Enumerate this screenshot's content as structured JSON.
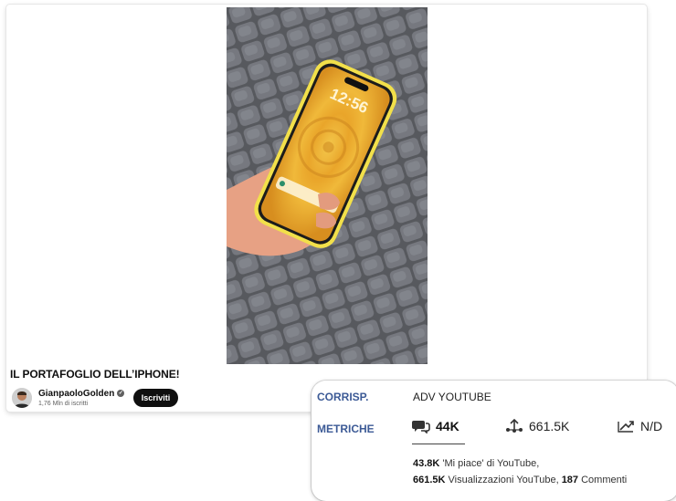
{
  "video": {
    "title": "IL PORTAFOGLIO DELL’IPHONE!",
    "channel_name": "GianpaoloGolden",
    "subscribers": "1,76 Mln di iscritti",
    "subscribe_label": "Iscriviti",
    "phone_time": "12:56"
  },
  "info_panel": {
    "corrisp_label": "CORRISP.",
    "corrisp_value": "ADV YOUTUBE",
    "metriche_label": "METRICHE",
    "metrics": [
      {
        "icon": "comments-icon",
        "value": "44K",
        "active": true
      },
      {
        "icon": "shares-icon",
        "value": "661.5K",
        "active": false
      },
      {
        "icon": "trend-icon",
        "value": "N/D",
        "active": false
      }
    ],
    "detail_line1": {
      "likes_value": "43.8K",
      "likes_text": " 'Mi piace' di YouTube,"
    },
    "detail_line2": {
      "views_value": "661.5K",
      "views_text": " Visualizzazioni YouTube, ",
      "comments_value": "187",
      "comments_text": " Commenti"
    }
  },
  "colors": {
    "label_blue": "#3c5a96",
    "phone_case": "#f2e04a",
    "wallpaper": "#f1b52a",
    "button_black": "#0f0f0f"
  }
}
